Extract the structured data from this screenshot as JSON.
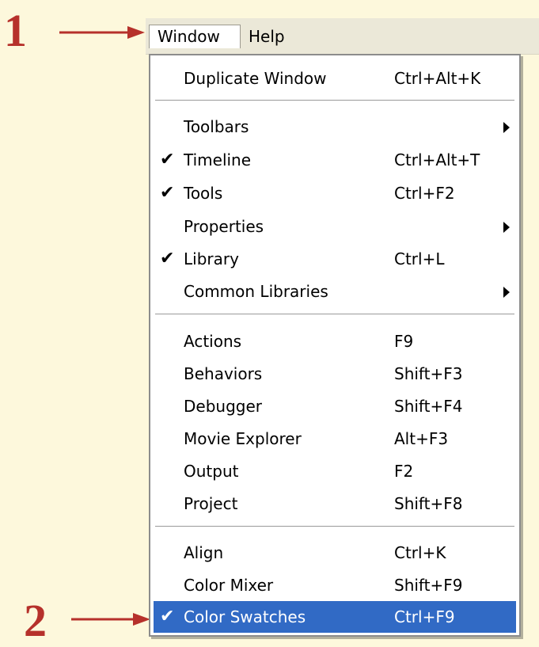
{
  "callouts": {
    "step1": "1",
    "step2": "2",
    "arrow_color": "#b6312b"
  },
  "menubar": {
    "window_label": "Window",
    "help_label": "Help"
  },
  "menu": {
    "items": [
      {
        "label": "Duplicate Window",
        "shortcut": "Ctrl+Alt+K",
        "checked": false,
        "submenu": false
      },
      {
        "label": "Toolbars",
        "shortcut": "",
        "checked": false,
        "submenu": true
      },
      {
        "label": "Timeline",
        "shortcut": "Ctrl+Alt+T",
        "checked": true,
        "submenu": false
      },
      {
        "label": "Tools",
        "shortcut": "Ctrl+F2",
        "checked": true,
        "submenu": false
      },
      {
        "label": "Properties",
        "shortcut": "",
        "checked": false,
        "submenu": true
      },
      {
        "label": "Library",
        "shortcut": "Ctrl+L",
        "checked": true,
        "submenu": false
      },
      {
        "label": "Common Libraries",
        "shortcut": "",
        "checked": false,
        "submenu": true
      },
      {
        "label": "Actions",
        "shortcut": "F9",
        "checked": false,
        "submenu": false
      },
      {
        "label": "Behaviors",
        "shortcut": "Shift+F3",
        "checked": false,
        "submenu": false
      },
      {
        "label": "Debugger",
        "shortcut": "Shift+F4",
        "checked": false,
        "submenu": false
      },
      {
        "label": "Movie Explorer",
        "shortcut": "Alt+F3",
        "checked": false,
        "submenu": false
      },
      {
        "label": "Output",
        "shortcut": "F2",
        "checked": false,
        "submenu": false
      },
      {
        "label": "Project",
        "shortcut": "Shift+F8",
        "checked": false,
        "submenu": false
      },
      {
        "label": "Align",
        "shortcut": "Ctrl+K",
        "checked": false,
        "submenu": false
      },
      {
        "label": "Color Mixer",
        "shortcut": "Shift+F9",
        "checked": false,
        "submenu": false
      },
      {
        "label": "Color Swatches",
        "shortcut": "Ctrl+F9",
        "checked": true,
        "submenu": false,
        "highlighted": true
      }
    ],
    "check_glyph": "✔",
    "highlight_color": "#316ac5"
  }
}
